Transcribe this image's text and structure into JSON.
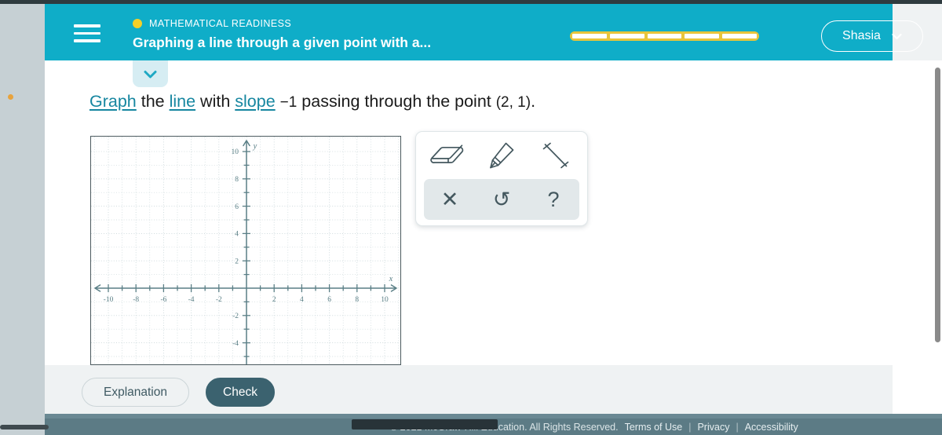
{
  "header": {
    "eyebrow": "MATHEMATICAL READINESS",
    "title": "Graphing a line through a given point with a...",
    "user_name": "Shasia",
    "menu_icon": "hamburger-icon",
    "progress_segments": 5,
    "accent_color": "#0fadc8",
    "progress_color": "#e8c53b"
  },
  "question": {
    "word_graph": "Graph",
    "text_the": " the ",
    "word_line": "line",
    "text_with": " with ",
    "word_slope": "slope",
    "slope_value": "−1",
    "text_passing": " passing through the point ",
    "point": "(2, 1)",
    "period": "."
  },
  "graph": {
    "x_label": "x",
    "y_label": "y",
    "x_min": -11,
    "x_max": 11,
    "y_min": -6,
    "y_max": 11,
    "x_ticks": [
      -10,
      -8,
      -6,
      -4,
      -2,
      2,
      4,
      6,
      8,
      10
    ],
    "y_ticks": [
      -4,
      -2,
      2,
      4,
      6,
      8,
      10
    ],
    "grid_step": 1,
    "axis_color": "#5a7f86",
    "grid_color": "#c9d6d9"
  },
  "palette": {
    "tools": [
      {
        "name": "eraser-tool",
        "icon": "eraser-icon"
      },
      {
        "name": "pencil-tool",
        "icon": "pencil-icon"
      },
      {
        "name": "line-tool",
        "icon": "line-segment-icon"
      }
    ],
    "actions": [
      {
        "name": "clear-action",
        "icon": "close-icon",
        "glyph": "✕"
      },
      {
        "name": "undo-action",
        "icon": "undo-icon",
        "glyph": "↺"
      },
      {
        "name": "help-action",
        "icon": "question-mark-icon",
        "glyph": "?"
      }
    ]
  },
  "buttons": {
    "explanation": "Explanation",
    "check": "Check"
  },
  "footer": {
    "copyright": "© 2021 McGraw-Hill Education. All Rights Reserved.",
    "terms": "Terms of Use",
    "privacy": "Privacy",
    "accessibility": "Accessibility",
    "separator": "|"
  }
}
